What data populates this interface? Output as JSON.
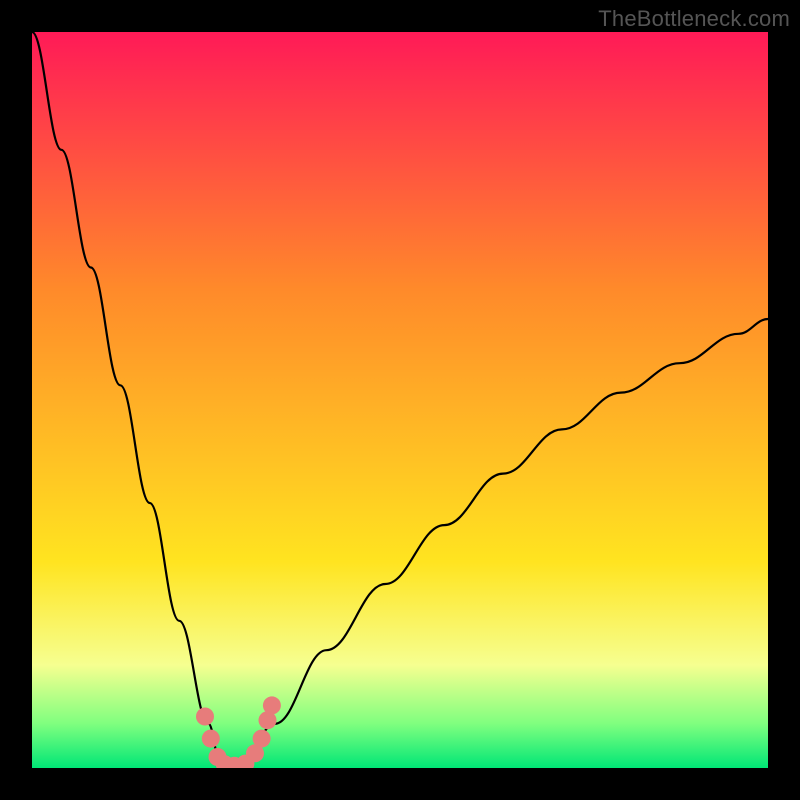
{
  "watermark": {
    "text": "TheBottleneck.com"
  },
  "chart_data": {
    "type": "line",
    "title": "",
    "xlabel": "",
    "ylabel": "",
    "xlim": [
      0,
      100
    ],
    "ylim": [
      0,
      100
    ],
    "background": {
      "gradient_top": "#ff1a57",
      "gradient_mid_upper": "#ff8a2a",
      "gradient_mid_lower": "#ffe420",
      "tail_start": "#f6ff90",
      "tail_mid": "#7fff7f",
      "tail_end": "#00e676"
    },
    "series": [
      {
        "name": "bottleneck-curve",
        "x": [
          0,
          4,
          8,
          12,
          16,
          20,
          24,
          25.5,
          27,
          28.5,
          33,
          40,
          48,
          56,
          64,
          72,
          80,
          88,
          96,
          100
        ],
        "y": [
          100,
          84,
          68,
          52,
          36,
          20,
          6,
          1,
          0,
          1,
          6,
          16,
          25,
          33,
          40,
          46,
          51,
          55,
          59,
          61
        ]
      }
    ],
    "markers": {
      "name": "fit-region",
      "points": [
        {
          "x": 23.5,
          "y": 7.0
        },
        {
          "x": 24.3,
          "y": 4.0
        },
        {
          "x": 25.2,
          "y": 1.5
        },
        {
          "x": 26.2,
          "y": 0.5
        },
        {
          "x": 27.5,
          "y": 0.3
        },
        {
          "x": 29.0,
          "y": 0.6
        },
        {
          "x": 30.3,
          "y": 2.0
        },
        {
          "x": 31.2,
          "y": 4.0
        },
        {
          "x": 32.0,
          "y": 6.5
        },
        {
          "x": 32.6,
          "y": 8.5
        }
      ],
      "radius_px": 9
    },
    "annotations": []
  }
}
